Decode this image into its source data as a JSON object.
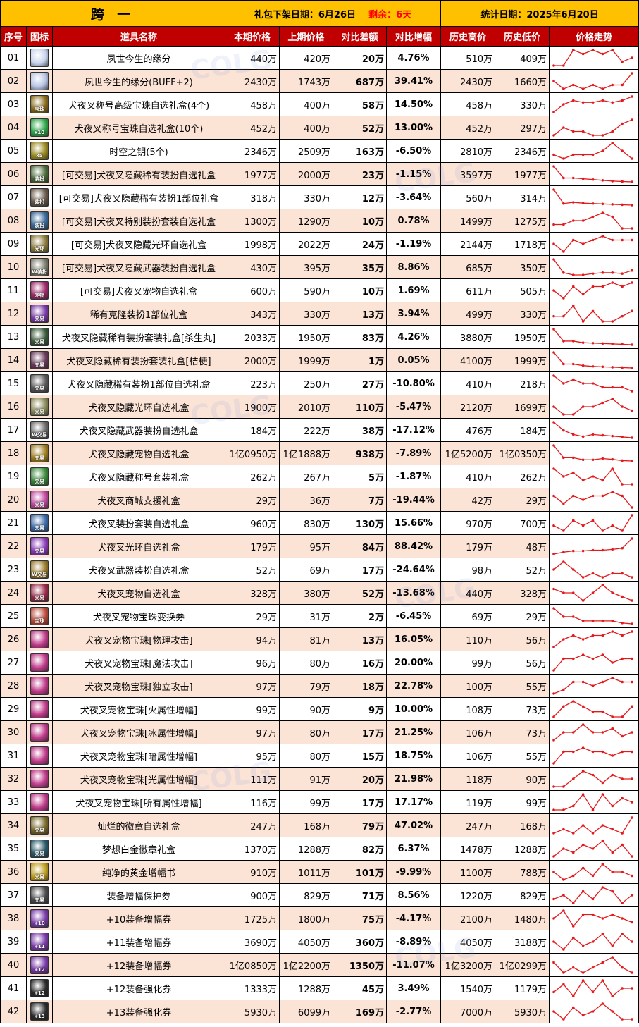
{
  "header": {
    "title": "跨 一",
    "release_label": "礼包下架日期：",
    "release_date": "6月26日",
    "remain_label": "剩余：",
    "remain_value": "6天",
    "stat_label": "统计日期：",
    "stat_date": "2025年6月20日"
  },
  "columns": [
    "序号",
    "图标",
    "道具名称",
    "本期价格",
    "上期价格",
    "对比差额",
    "对比增幅",
    "历史高价",
    "历史低价",
    "价格走势"
  ],
  "colors": {
    "header_bar": "#ffc000",
    "column_header": "#c00000",
    "row_alt": "#fbe3d6",
    "increase": "#ff0000",
    "decrease": "#00b050",
    "trend_line": "#e31a1c"
  },
  "rows": [
    {
      "id": "01",
      "icon": "pale-spirit-icon",
      "icon_color": "#c8d4ec",
      "icon_text": "",
      "name": "夙世今生的缘分",
      "cur": "440万",
      "prev": "420万",
      "diff": "20万",
      "pct": "4.76%",
      "dir": "up",
      "high": "510万",
      "low": "409万",
      "trend": [
        1,
        1,
        5,
        4,
        5,
        4,
        5,
        2,
        3
      ]
    },
    {
      "id": "02",
      "icon": "pale-spirit-icon",
      "icon_color": "#b8c4e4",
      "icon_text": "",
      "name": "夙世今生的缘分(BUFF+2)",
      "cur": "2430万",
      "prev": "1743万",
      "diff": "687万",
      "pct": "39.41%",
      "dir": "up",
      "high": "2430万",
      "low": "1660万",
      "trend": [
        3,
        1,
        2,
        1,
        2,
        1,
        2,
        2,
        5
      ]
    },
    {
      "id": "03",
      "icon": "gold-gem-box-icon",
      "icon_color": "#8a6a1a",
      "icon_text": "宝珠",
      "name": "犬夜叉称号高级宝珠自选礼盒(4个)",
      "cur": "458万",
      "prev": "400万",
      "diff": "58万",
      "pct": "14.50%",
      "dir": "up",
      "high": "458万",
      "low": "330万",
      "trend": [
        1,
        3,
        4,
        3.5,
        3.5,
        4,
        3.5,
        4,
        5
      ]
    },
    {
      "id": "04",
      "icon": "green-gem-box-icon",
      "icon_color": "#2da84a",
      "icon_text": "x10",
      "name": "犬夜叉称号宝珠自选礼盒(10个)",
      "cur": "452万",
      "prev": "400万",
      "diff": "52万",
      "pct": "13.00%",
      "dir": "up",
      "high": "452万",
      "low": "297万",
      "trend": [
        1,
        3,
        2,
        2,
        1,
        1,
        2,
        4,
        5
      ]
    },
    {
      "id": "05",
      "icon": "gold-key-icon",
      "icon_color": "#9a8a20",
      "icon_text": "x5",
      "name": "时空之钥(5个)",
      "cur": "2346万",
      "prev": "2509万",
      "diff": "163万",
      "pct": "-6.50%",
      "dir": "down",
      "high": "2810万",
      "low": "2346万",
      "trend": [
        2,
        1,
        2,
        2,
        2,
        3,
        5,
        3,
        1
      ]
    },
    {
      "id": "06",
      "icon": "avatar-box-icon",
      "icon_color": "#4a6a3a",
      "icon_text": "装扮",
      "name": "[可交易]犬夜叉隐藏稀有装扮自选礼盒",
      "cur": "1977万",
      "prev": "2000万",
      "diff": "23万",
      "pct": "-1.15%",
      "dir": "down",
      "high": "3597万",
      "low": "1977万",
      "trend": [
        5,
        2,
        2,
        1.8,
        1.6,
        1.4,
        1.2,
        1.1,
        1
      ]
    },
    {
      "id": "07",
      "icon": "avatar-part-box-icon",
      "icon_color": "#6a5a4a",
      "icon_text": "装扮",
      "name": "[可交易]犬夜叉隐藏稀有装扮1部位礼盒",
      "cur": "318万",
      "prev": "330万",
      "diff": "12万",
      "pct": "-3.64%",
      "dir": "down",
      "high": "560万",
      "low": "314万",
      "trend": [
        5,
        1.5,
        1.8,
        1.6,
        1.5,
        1.4,
        1.3,
        1.2,
        1.1
      ]
    },
    {
      "id": "08",
      "icon": "special-avatar-box-icon",
      "icon_color": "#3a6a9a",
      "icon_text": "装扮",
      "name": "[可交易]犬夜叉特别装扮套装自选礼盒",
      "cur": "1300万",
      "prev": "1290万",
      "diff": "10万",
      "pct": "0.78%",
      "dir": "up",
      "high": "1499万",
      "low": "1275万",
      "trend": [
        2,
        2,
        3,
        3,
        4,
        5,
        4,
        1,
        1
      ]
    },
    {
      "id": "09",
      "icon": "aura-box-icon",
      "icon_color": "#8a7a3a",
      "icon_text": "光环",
      "name": "[可交易]犬夜叉隐藏光环自选礼盒",
      "cur": "1998万",
      "prev": "2022万",
      "diff": "24万",
      "pct": "-1.19%",
      "dir": "down",
      "high": "2144万",
      "low": "1718万",
      "trend": [
        3,
        1,
        4,
        3,
        4,
        5,
        4,
        4,
        4
      ]
    },
    {
      "id": "10",
      "icon": "weapon-avatar-box-icon",
      "icon_color": "#7a7a6a",
      "icon_text": "W装扮",
      "name": "[可交易]犬夜叉隐藏武器装扮自选礼盒",
      "cur": "430万",
      "prev": "395万",
      "diff": "35万",
      "pct": "8.86%",
      "dir": "up",
      "high": "685万",
      "low": "350万",
      "trend": [
        5,
        2,
        1.5,
        1.5,
        1.8,
        2,
        2,
        1.8,
        2.5
      ]
    },
    {
      "id": "11",
      "icon": "pet-box-icon",
      "icon_color": "#a02a6a",
      "icon_text": "宠物",
      "name": "[可交易]犬夜叉宠物自选礼盒",
      "cur": "600万",
      "prev": "590万",
      "diff": "10万",
      "pct": "1.69%",
      "dir": "up",
      "high": "611万",
      "low": "505万",
      "trend": [
        3,
        1,
        4,
        2,
        4,
        4,
        5,
        4,
        5
      ]
    },
    {
      "id": "12",
      "icon": "purple-orb-icon",
      "icon_color": "#7a3aaa",
      "icon_text": "交易",
      "name": "稀有克隆装扮1部位礼盒",
      "cur": "343万",
      "prev": "330万",
      "diff": "13万",
      "pct": "3.94%",
      "dir": "up",
      "high": "499万",
      "low": "330万",
      "trend": [
        3,
        3,
        5,
        2,
        4,
        2,
        2,
        3,
        4
      ]
    },
    {
      "id": "13",
      "icon": "green-chest-icon",
      "icon_color": "#3a5a3a",
      "icon_text": "交易",
      "name": "犬夜叉隐藏稀有装扮套装礼盒[杀生丸]",
      "cur": "2033万",
      "prev": "1950万",
      "diff": "83万",
      "pct": "4.26%",
      "dir": "up",
      "high": "3880万",
      "low": "1950万",
      "trend": [
        5,
        2,
        2,
        1.6,
        1.5,
        1.4,
        1.3,
        1.2,
        1.1
      ]
    },
    {
      "id": "14",
      "icon": "red-chest-icon",
      "icon_color": "#6a3a5a",
      "icon_text": "交易",
      "name": "犬夜叉隐藏稀有装扮套装礼盒[桔梗]",
      "cur": "2000万",
      "prev": "1999万",
      "diff": "1万",
      "pct": "0.05%",
      "dir": "up",
      "high": "4100万",
      "low": "1999万",
      "trend": [
        5,
        2,
        2,
        1.6,
        1.4,
        1.3,
        1.2,
        1.1,
        1
      ]
    },
    {
      "id": "15",
      "icon": "avatar-part-box-icon",
      "icon_color": "#5a5a5a",
      "icon_text": "交易",
      "name": "犬夜叉隐藏稀有装扮1部位自选礼盒",
      "cur": "223万",
      "prev": "250万",
      "diff": "27万",
      "pct": "-10.80%",
      "dir": "down",
      "high": "410万",
      "low": "218万",
      "trend": [
        5,
        3,
        4,
        3,
        3,
        2,
        2,
        2,
        1
      ]
    },
    {
      "id": "16",
      "icon": "aura-chest-icon",
      "icon_color": "#8a8a5a",
      "icon_text": "交易",
      "name": "犬夜叉隐藏光环自选礼盒",
      "cur": "1900万",
      "prev": "2010万",
      "diff": "110万",
      "pct": "-5.47%",
      "dir": "down",
      "high": "2120万",
      "low": "1699万",
      "trend": [
        3,
        1,
        1,
        3,
        3,
        4,
        5,
        3,
        2
      ]
    },
    {
      "id": "17",
      "icon": "weapon-chest-icon",
      "icon_color": "#6a6a6a",
      "icon_text": "W交易",
      "name": "犬夜叉隐藏武器装扮自选礼盒",
      "cur": "184万",
      "prev": "222万",
      "diff": "38万",
      "pct": "-17.12%",
      "dir": "down",
      "high": "476万",
      "low": "184万",
      "trend": [
        5,
        3,
        2,
        1.5,
        2,
        1.8,
        1.6,
        1.4,
        1.2
      ]
    },
    {
      "id": "18",
      "icon": "gold-pet-chest-icon",
      "icon_color": "#a08020",
      "icon_text": "交易",
      "name": "犬夜叉隐藏宠物自选礼盒",
      "cur": "1亿0950万",
      "prev": "1亿1888万",
      "diff": "938万",
      "pct": "-7.89%",
      "dir": "down",
      "high": "1亿5200万",
      "low": "1亿0350万",
      "trend": [
        5,
        2,
        2,
        1.5,
        1.5,
        1.8,
        1.6,
        1.3,
        1.2
      ]
    },
    {
      "id": "19",
      "icon": "green-title-chest-icon",
      "icon_color": "#3a8a3a",
      "icon_text": "交易",
      "name": "犬夜叉隐藏称号套装礼盒",
      "cur": "262万",
      "prev": "267万",
      "diff": "5万",
      "pct": "-1.87%",
      "dir": "down",
      "high": "410万",
      "low": "262万",
      "trend": [
        5,
        3,
        4,
        2,
        3,
        2,
        5,
        1,
        1
      ]
    },
    {
      "id": "20",
      "icon": "pink-box-icon",
      "icon_color": "#c04aa0",
      "icon_text": "交易",
      "name": "犬夜叉商城支援礼盒",
      "cur": "29万",
      "prev": "36万",
      "diff": "7万",
      "pct": "-19.44%",
      "dir": "down",
      "high": "42万",
      "low": "29万",
      "trend": [
        4,
        2,
        4,
        3,
        4,
        4,
        5,
        4,
        1
      ]
    },
    {
      "id": "21",
      "icon": "blue-avatar-chest-icon",
      "icon_color": "#3a6aaa",
      "icon_text": "交易",
      "name": "犬夜叉装扮套装自选礼盒",
      "cur": "960万",
      "prev": "830万",
      "diff": "130万",
      "pct": "15.66%",
      "dir": "up",
      "high": "970万",
      "low": "700万",
      "trend": [
        3,
        2,
        4,
        3,
        4,
        2,
        3,
        2,
        5
      ]
    },
    {
      "id": "22",
      "icon": "purple-aura-chest-icon",
      "icon_color": "#8a3aba",
      "icon_text": "交易",
      "name": "犬夜叉光环自选礼盒",
      "cur": "179万",
      "prev": "95万",
      "diff": "84万",
      "pct": "88.42%",
      "dir": "up",
      "high": "179万",
      "low": "48万",
      "trend": [
        1,
        1.5,
        1.8,
        1.8,
        2,
        2,
        2.2,
        2.5,
        5
      ]
    },
    {
      "id": "23",
      "icon": "weapon-chest-icon",
      "icon_color": "#9a7a2a",
      "icon_text": "W交易",
      "name": "犬夜叉武器装扮自选礼盒",
      "cur": "52万",
      "prev": "69万",
      "diff": "17万",
      "pct": "-24.64%",
      "dir": "down",
      "high": "98万",
      "low": "52万",
      "trend": [
        3,
        5,
        3,
        1,
        2,
        1,
        2,
        2,
        1
      ]
    },
    {
      "id": "24",
      "icon": "red-pet-chest-icon",
      "icon_color": "#9a2a4a",
      "icon_text": "交易",
      "name": "犬夜叉宠物自选礼盒",
      "cur": "328万",
      "prev": "380万",
      "diff": "52万",
      "pct": "-13.68%",
      "dir": "down",
      "high": "440万",
      "low": "328万",
      "trend": [
        4,
        3,
        3,
        1,
        3,
        5,
        3,
        2,
        1
      ]
    },
    {
      "id": "25",
      "icon": "pet-gem-ticket-icon",
      "icon_color": "#ba4a3a",
      "icon_text": "宝珠",
      "name": "犬夜叉宠物宝珠变换券",
      "cur": "29万",
      "prev": "31万",
      "diff": "2万",
      "pct": "-6.45%",
      "dir": "down",
      "high": "69万",
      "low": "29万",
      "trend": [
        5,
        3,
        3,
        2,
        2,
        2,
        2,
        1.5,
        1.3
      ]
    },
    {
      "id": "26",
      "icon": "pet-gem-icon",
      "icon_color": "#c03a8a",
      "icon_text": "",
      "name": "犬夜叉宠物宝珠[物理攻击]",
      "cur": "94万",
      "prev": "81万",
      "diff": "13万",
      "pct": "16.05%",
      "dir": "up",
      "high": "110万",
      "low": "56万",
      "trend": [
        1,
        3,
        4,
        3,
        4,
        4,
        5,
        4,
        5
      ]
    },
    {
      "id": "27",
      "icon": "pet-gem-icon",
      "icon_color": "#c03a8a",
      "icon_text": "",
      "name": "犬夜叉宠物宝珠[魔法攻击]",
      "cur": "96万",
      "prev": "80万",
      "diff": "16万",
      "pct": "20.00%",
      "dir": "up",
      "high": "99万",
      "low": "56万",
      "trend": [
        1,
        4,
        4,
        5,
        4,
        5,
        3,
        4,
        4
      ]
    },
    {
      "id": "28",
      "icon": "pet-gem-icon",
      "icon_color": "#c03a8a",
      "icon_text": "",
      "name": "犬夜叉宠物宝珠[独立攻击]",
      "cur": "97万",
      "prev": "79万",
      "diff": "18万",
      "pct": "22.78%",
      "dir": "up",
      "high": "100万",
      "low": "55万",
      "trend": [
        1,
        2,
        4,
        4,
        3,
        4,
        5,
        4,
        4
      ]
    },
    {
      "id": "29",
      "icon": "pet-gem-icon",
      "icon_color": "#c03a8a",
      "icon_text": "",
      "name": "犬夜叉宠物宝珠[火属性增幅]",
      "cur": "99万",
      "prev": "90万",
      "diff": "9万",
      "pct": "10.00%",
      "dir": "up",
      "high": "108万",
      "low": "73万",
      "trend": [
        2,
        4,
        5,
        4,
        3,
        3,
        2,
        2,
        4
      ]
    },
    {
      "id": "30",
      "icon": "pet-gem-icon",
      "icon_color": "#c03a8a",
      "icon_text": "",
      "name": "犬夜叉宠物宝珠[冰属性增幅]",
      "cur": "97万",
      "prev": "80万",
      "diff": "17万",
      "pct": "21.25%",
      "dir": "up",
      "high": "106万",
      "low": "73万",
      "trend": [
        1,
        3,
        3,
        5,
        3,
        3,
        4,
        2,
        3
      ]
    },
    {
      "id": "31",
      "icon": "pet-gem-icon",
      "icon_color": "#c03a8a",
      "icon_text": "",
      "name": "犬夜叉宠物宝珠[暗属性增幅]",
      "cur": "95万",
      "prev": "80万",
      "diff": "15万",
      "pct": "18.75%",
      "dir": "up",
      "high": "106万",
      "low": "55万",
      "trend": [
        1,
        4,
        4,
        5,
        4,
        4,
        3,
        4,
        4
      ]
    },
    {
      "id": "32",
      "icon": "pet-gem-icon",
      "icon_color": "#c03a8a",
      "icon_text": "",
      "name": "犬夜叉宠物宝珠[光属性增幅]",
      "cur": "111万",
      "prev": "91万",
      "diff": "20万",
      "pct": "21.98%",
      "dir": "up",
      "high": "118万",
      "low": "90万",
      "trend": [
        1,
        1,
        3,
        5,
        4,
        2,
        4,
        3,
        3
      ]
    },
    {
      "id": "33",
      "icon": "pet-gem-icon",
      "icon_color": "#c03a8a",
      "icon_text": "",
      "name": "犬夜叉宠物宝珠[所有属性增幅]",
      "cur": "116万",
      "prev": "99万",
      "diff": "17万",
      "pct": "17.17%",
      "dir": "up",
      "high": "119万",
      "low": "99万",
      "trend": [
        1,
        1,
        2,
        5,
        1,
        5,
        2,
        4,
        3
      ]
    },
    {
      "id": "34",
      "icon": "emblem-box-icon",
      "icon_color": "#7a6a2a",
      "icon_text": "交易",
      "name": "灿烂的徽章自选礼盒",
      "cur": "247万",
      "prev": "168万",
      "diff": "79万",
      "pct": "47.02%",
      "dir": "up",
      "high": "247万",
      "low": "168万",
      "trend": [
        1,
        2,
        1,
        3,
        1,
        3,
        2,
        1,
        5
      ]
    },
    {
      "id": "35",
      "icon": "platinum-emblem-icon",
      "icon_color": "#2a5a6a",
      "icon_text": "交易",
      "name": "梦想白金徽章礼盒",
      "cur": "1370万",
      "prev": "1288万",
      "diff": "82万",
      "pct": "6.37%",
      "dir": "up",
      "high": "1478万",
      "low": "1288万",
      "trend": [
        1,
        3,
        2,
        4,
        3,
        5,
        2,
        4,
        1
      ]
    },
    {
      "id": "36",
      "icon": "gold-scroll-icon",
      "icon_color": "#c0a020",
      "icon_text": "交易",
      "name": "纯净的黄金增幅书",
      "cur": "910万",
      "prev": "1011万",
      "diff": "101万",
      "pct": "-9.99%",
      "dir": "down",
      "high": "1100万",
      "low": "788万",
      "trend": [
        3,
        1,
        2,
        4,
        2,
        5,
        3,
        3,
        2
      ]
    },
    {
      "id": "37",
      "icon": "protect-ticket-icon",
      "icon_color": "#4a4a4a",
      "icon_text": "交易",
      "name": "装备增幅保护券",
      "cur": "900万",
      "prev": "829万",
      "diff": "71万",
      "pct": "8.56%",
      "dir": "up",
      "high": "1220万",
      "low": "829万",
      "trend": [
        2,
        3,
        1,
        4,
        2,
        5,
        4,
        1,
        3
      ]
    },
    {
      "id": "38",
      "icon": "amp-ticket-icon",
      "icon_color": "#7a3aaa",
      "icon_text": "+10",
      "name": "+10装备增幅券",
      "cur": "1725万",
      "prev": "1800万",
      "diff": "75万",
      "pct": "-4.17%",
      "dir": "down",
      "high": "2100万",
      "low": "1480万",
      "trend": [
        3,
        5,
        1,
        4,
        4,
        3,
        4,
        3,
        2
      ]
    },
    {
      "id": "39",
      "icon": "amp-ticket-icon",
      "icon_color": "#7a3aaa",
      "icon_text": "+11",
      "name": "+11装备增幅券",
      "cur": "3690万",
      "prev": "4050万",
      "diff": "360万",
      "pct": "-8.89%",
      "dir": "down",
      "high": "4050万",
      "low": "3188万",
      "trend": [
        3,
        1,
        4,
        2,
        3,
        5,
        2,
        5,
        3
      ]
    },
    {
      "id": "40",
      "icon": "amp-ticket-icon",
      "icon_color": "#7a3aaa",
      "icon_text": "+12",
      "name": "+12装备增幅券",
      "cur": "1亿0850万",
      "prev": "1亿2200万",
      "diff": "1350万",
      "pct": "-11.07%",
      "dir": "down",
      "high": "1亿3200万",
      "low": "1亿0299万",
      "trend": [
        4,
        2,
        3,
        2,
        3,
        4,
        5,
        3,
        2
      ]
    },
    {
      "id": "41",
      "icon": "enhance-ticket-icon",
      "icon_color": "#2a2a2a",
      "icon_text": "+12",
      "name": "+12装备强化券",
      "cur": "1333万",
      "prev": "1288万",
      "diff": "45万",
      "pct": "3.49%",
      "dir": "up",
      "high": "1540万",
      "low": "1179万",
      "trend": [
        2,
        4,
        1,
        5,
        2,
        5,
        1,
        3,
        3
      ]
    },
    {
      "id": "42",
      "icon": "enhance-ticket-icon",
      "icon_color": "#2a2a2a",
      "icon_text": "+13",
      "name": "+13装备强化券",
      "cur": "5930万",
      "prev": "6099万",
      "diff": "169万",
      "pct": "-2.77%",
      "dir": "down",
      "high": "7000万",
      "low": "5930万",
      "trend": [
        3,
        1,
        4,
        2,
        3,
        5,
        3,
        1,
        1
      ]
    }
  ]
}
